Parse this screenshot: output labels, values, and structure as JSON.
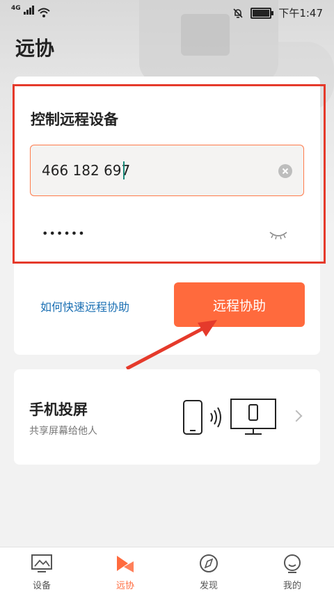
{
  "status_bar": {
    "network": "4G",
    "time": "下午1:47"
  },
  "page": {
    "title": "远协"
  },
  "control_card": {
    "title": "控制远程设备",
    "device_id_value": "466 182 697",
    "password_value": "••••••",
    "help_link": "如何快速远程协助",
    "assist_button": "远程协助"
  },
  "cast_card": {
    "title": "手机投屏",
    "subtitle": "共享屏幕给他人"
  },
  "tabbar": {
    "items": [
      {
        "label": "设备",
        "icon": "monitor-icon",
        "active": false
      },
      {
        "label": "远协",
        "icon": "remote-assist-icon",
        "active": true
      },
      {
        "label": "发现",
        "icon": "compass-icon",
        "active": false
      },
      {
        "label": "我的",
        "icon": "profile-icon",
        "active": false
      }
    ]
  },
  "colors": {
    "accent": "#ff6a3d",
    "highlight_box": "#e53a2b",
    "link": "#1a6fb3"
  }
}
